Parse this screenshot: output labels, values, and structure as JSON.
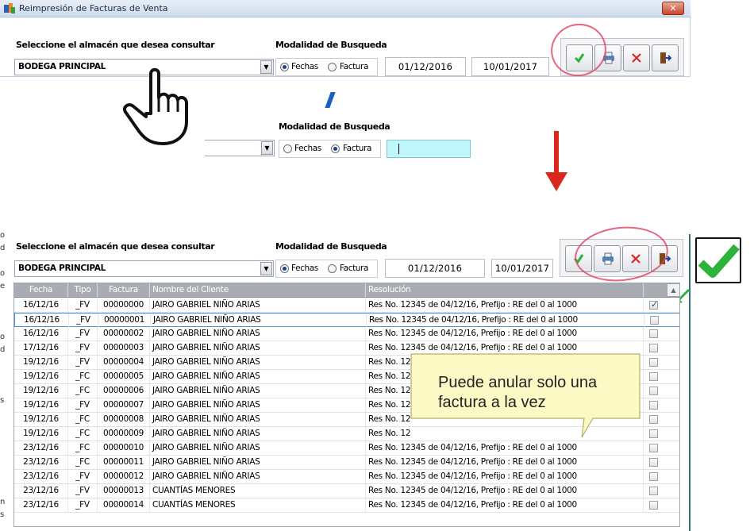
{
  "window": {
    "title": "Reimpresión de Facturas de Venta",
    "close_label": "✕"
  },
  "filter": {
    "warehouse_label": "Seleccione el almacén que desea consultar",
    "warehouse_value": "BODEGA PRINCIPAL",
    "mode_label": "Modalidad de Busqueda",
    "radio_fechas": "Fechas",
    "radio_factura": "Factura",
    "date_from": "01/12/2016",
    "date_to": "10/01/2017"
  },
  "toolbar": {
    "confirm_icon": "check-icon",
    "print_icon": "printer-icon",
    "cancel_icon": "x-icon",
    "exit_icon": "exit-door-icon"
  },
  "grid": {
    "columns": [
      "Fecha",
      "Tipo",
      "Factura",
      "Nombre del Cliente",
      "Resolución"
    ],
    "rows": [
      {
        "fecha": "16/12/16",
        "tipo": "_FV",
        "factura": "00000000",
        "cliente": "JAIRO GABRIEL NIÑO ARIAS",
        "resolucion": "Res No. 12345 de 04/12/16, Prefijo : RE del 0 al 1000",
        "checked": true
      },
      {
        "fecha": "16/12/16",
        "tipo": "_FV",
        "factura": "00000001",
        "cliente": "JAIRO GABRIEL NIÑO ARIAS",
        "resolucion": "Res No. 12345 de 04/12/16, Prefijo : RE del 0 al 1000",
        "checked": false
      },
      {
        "fecha": "16/12/16",
        "tipo": "_FV",
        "factura": "00000002",
        "cliente": "JAIRO GABRIEL NIÑO ARIAS",
        "resolucion": "Res No. 12345 de 04/12/16, Prefijo : RE del 0 al 1000",
        "checked": false
      },
      {
        "fecha": "17/12/16",
        "tipo": "_FV",
        "factura": "00000003",
        "cliente": "JAIRO GABRIEL NIÑO ARIAS",
        "resolucion": "Res No. 12345 de 04/12/16, Prefijo : RE del 0 al 1000",
        "checked": false
      },
      {
        "fecha": "19/12/16",
        "tipo": "_FV",
        "factura": "00000004",
        "cliente": "JAIRO GABRIEL NIÑO ARIAS",
        "resolucion": "Res No. 12",
        "checked": false
      },
      {
        "fecha": "19/12/16",
        "tipo": "_FC",
        "factura": "00000005",
        "cliente": "JAIRO GABRIEL NIÑO ARIAS",
        "resolucion": "Res No. 12",
        "checked": false
      },
      {
        "fecha": "19/12/16",
        "tipo": "_FC",
        "factura": "00000006",
        "cliente": "JAIRO GABRIEL NIÑO ARIAS",
        "resolucion": "Res No. 12",
        "checked": false
      },
      {
        "fecha": "19/12/16",
        "tipo": "_FV",
        "factura": "00000007",
        "cliente": "JAIRO GABRIEL NIÑO ARIAS",
        "resolucion": "Res No. 12",
        "checked": false
      },
      {
        "fecha": "19/12/16",
        "tipo": "_FC",
        "factura": "00000008",
        "cliente": "JAIRO GABRIEL NIÑO ARIAS",
        "resolucion": "Res No. 12",
        "checked": false
      },
      {
        "fecha": "19/12/16",
        "tipo": "_FC",
        "factura": "00000009",
        "cliente": "JAIRO GABRIEL NIÑO ARIAS",
        "resolucion": "Res No. 12",
        "checked": false
      },
      {
        "fecha": "23/12/16",
        "tipo": "_FC",
        "factura": "00000010",
        "cliente": "JAIRO GABRIEL NIÑO ARIAS",
        "resolucion": "Res No. 12345 de 04/12/16, Prefijo : RE del 0 al 1000",
        "checked": false
      },
      {
        "fecha": "23/12/16",
        "tipo": "_FC",
        "factura": "00000011",
        "cliente": "JAIRO GABRIEL NIÑO ARIAS",
        "resolucion": "Res No. 12345 de 04/12/16, Prefijo : RE del 0 al 1000",
        "checked": false
      },
      {
        "fecha": "23/12/16",
        "tipo": "_FV",
        "factura": "00000012",
        "cliente": "JAIRO GABRIEL NIÑO ARIAS",
        "resolucion": "Res No. 12345 de 04/12/16, Prefijo : RE del 0 al 1000",
        "checked": false
      },
      {
        "fecha": "23/12/16",
        "tipo": "_FV",
        "factura": "00000013",
        "cliente": "CUANTÍAS MENORES",
        "resolucion": "Res No. 12345 de 04/12/16, Prefijo : RE del 0 al 1000",
        "checked": false
      },
      {
        "fecha": "23/12/16",
        "tipo": "_FV",
        "factura": "00000014",
        "cliente": "CUANTÍAS MENORES",
        "resolucion": "Res No. 12345 de 04/12/16, Prefijo : RE del 0 al 1000",
        "checked": false
      }
    ]
  },
  "callout": {
    "text": "Puede anular solo una factura a la vez"
  },
  "left_edge_marks": [
    "o",
    "d",
    "",
    "o",
    "e",
    "",
    "",
    "",
    "o",
    "d",
    "",
    "",
    "",
    "s",
    "",
    "",
    "",
    "",
    "",
    "",
    "",
    "n",
    "s"
  ],
  "colors": {
    "accent_green": "#2bb33a",
    "annotation_red": "#e04060",
    "arrow_red": "#d9271c",
    "cyan_field": "#bff7fb"
  }
}
